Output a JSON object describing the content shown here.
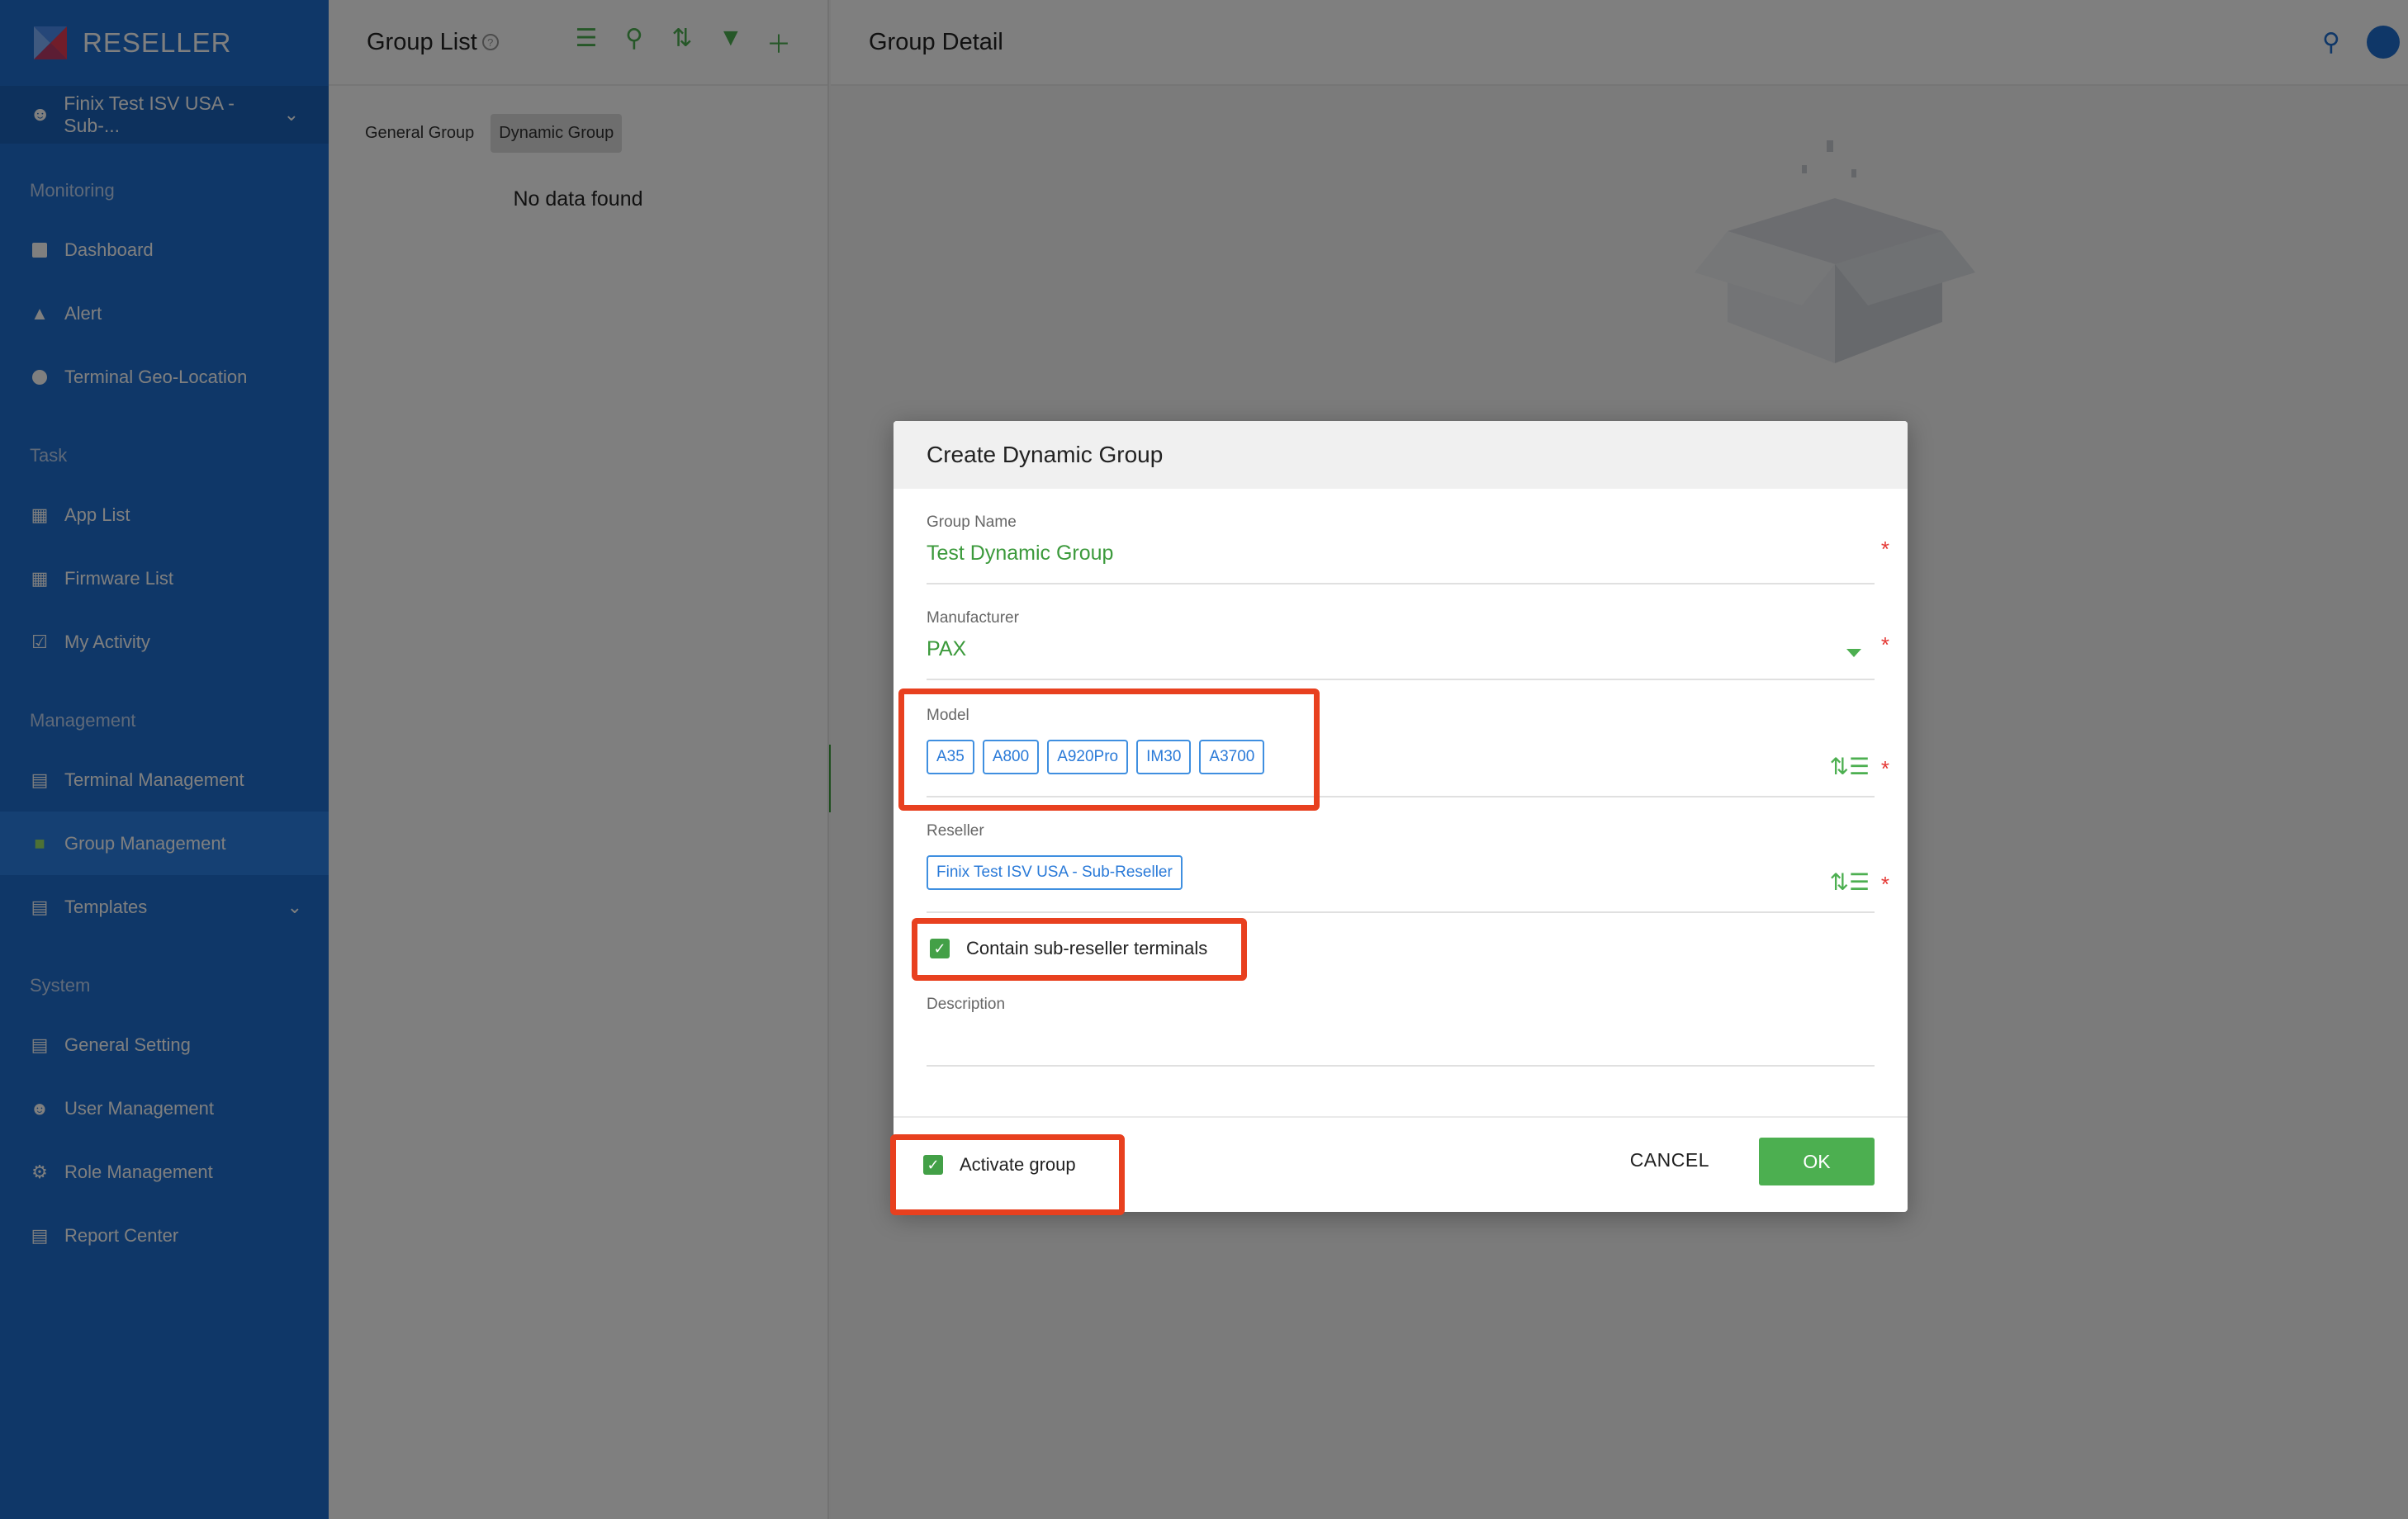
{
  "app": {
    "name": "RESELLER"
  },
  "sidebar": {
    "account": "Finix Test ISV USA - Sub-...",
    "sections": [
      {
        "title": "Monitoring",
        "items": [
          "Dashboard",
          "Alert",
          "Terminal Geo-Location"
        ]
      },
      {
        "title": "Task",
        "items": [
          "App List",
          "Firmware List",
          "My Activity"
        ]
      },
      {
        "title": "Management",
        "items": [
          "Terminal Management",
          "Group Management",
          "Templates"
        ]
      },
      {
        "title": "System",
        "items": [
          "General Setting",
          "User Management",
          "Role Management",
          "Report Center"
        ]
      }
    ],
    "active_item": "Group Management"
  },
  "group_list": {
    "title": "Group List",
    "help": "?",
    "tabs": [
      "General Group",
      "Dynamic Group"
    ],
    "active_tab": "Dynamic Group",
    "empty_text": "No data found"
  },
  "detail": {
    "title": "Group Detail"
  },
  "modal": {
    "title": "Create Dynamic Group",
    "group_name_label": "Group Name",
    "group_name_value": "Test Dynamic Group",
    "manufacturer_label": "Manufacturer",
    "manufacturer_value": "PAX",
    "model_label": "Model",
    "models": [
      "A35",
      "A800",
      "A920Pro",
      "IM30",
      "A3700"
    ],
    "reseller_label": "Reseller",
    "reseller_value": "Finix Test ISV USA - Sub-Reseller",
    "contain_sub_label": "Contain sub-reseller terminals",
    "description_label": "Description",
    "activate_label": "Activate group",
    "cancel_label": "CANCEL",
    "ok_label": "OK",
    "required_mark": "*"
  },
  "colors": {
    "sidebar": "#1f6fd0",
    "accent_green": "#4caf50",
    "highlight": "#e8401f",
    "chip_blue": "#2a7ad8"
  }
}
